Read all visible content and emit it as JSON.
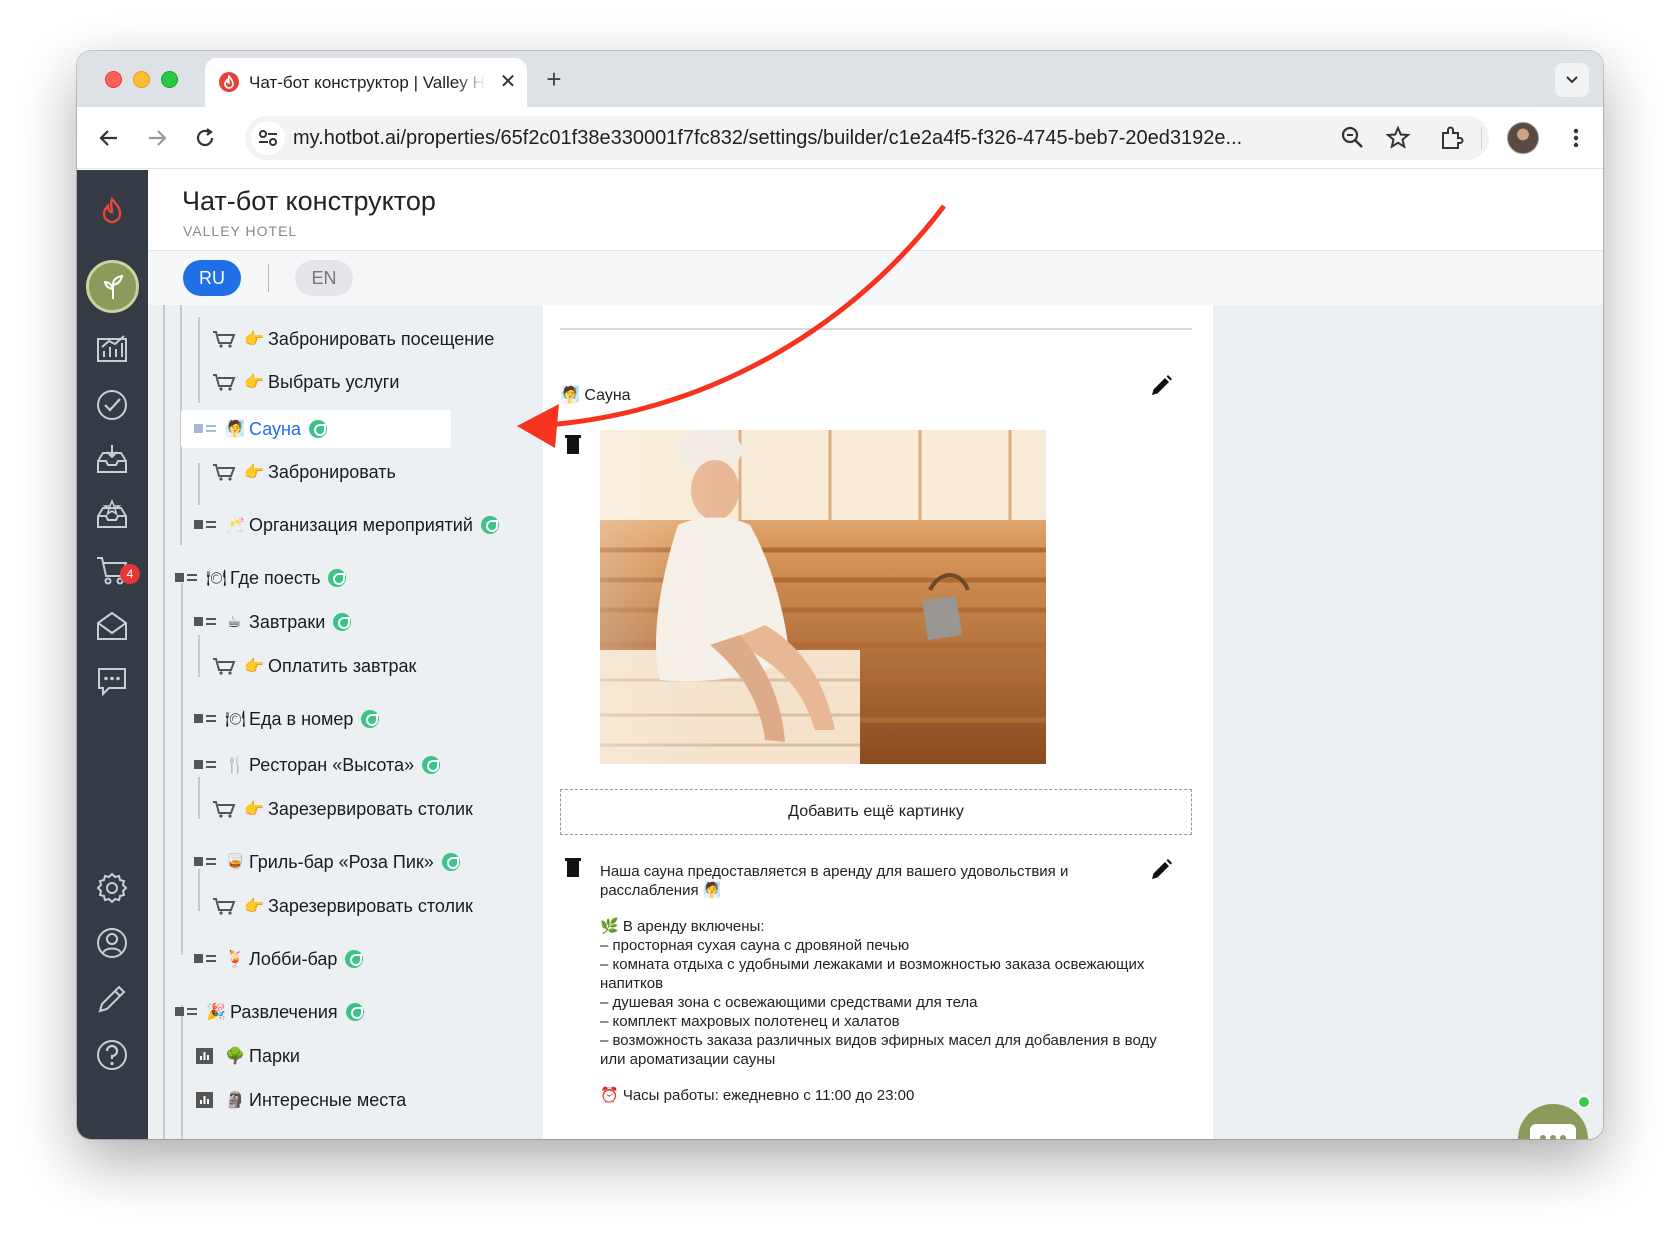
{
  "browser": {
    "tab_title": "Чат-бот конструктор | Valley Hotel",
    "url": "my.hotbot.ai/properties/65f2c01f38e330001f7fc832/settings/builder/c1e2a4f5-f326-4745-beb7-20ed3192e..."
  },
  "header": {
    "title": "Чат-бот конструктор",
    "subtitle": "VALLEY HOTEL"
  },
  "languages": [
    "RU",
    "EN"
  ],
  "rail": {
    "cart_badge": "4"
  },
  "tree": {
    "items": [
      {
        "label": "Забронировать посещение",
        "emoji": "👉"
      },
      {
        "label": "Выбрать услуги",
        "emoji": "👉"
      },
      {
        "label": "Сауна",
        "emoji": "🧖"
      },
      {
        "label": "Забронировать",
        "emoji": "👉"
      },
      {
        "label": "Организация мероприятий",
        "emoji": "🥂"
      },
      {
        "label": "Где поесть",
        "emoji": "🍽"
      },
      {
        "label": "Завтраки",
        "emoji": "☕"
      },
      {
        "label": "Оплатить завтрак",
        "emoji": "👉"
      },
      {
        "label": "Еда в номер",
        "emoji": "🍽"
      },
      {
        "label": "Ресторан «Высота»",
        "emoji": "🍴"
      },
      {
        "label": "Зарезервировать столик",
        "emoji": "👉"
      },
      {
        "label": "Гриль-бар «Роза Пик»",
        "emoji": "🥃"
      },
      {
        "label": "Зарезервировать столик",
        "emoji": "👉"
      },
      {
        "label": "Лобби-бар",
        "emoji": "🍹"
      },
      {
        "label": "Развлечения",
        "emoji": "🎉"
      },
      {
        "label": "Парки",
        "emoji": "🌳"
      },
      {
        "label": "Интересные места",
        "emoji": "🗿"
      }
    ]
  },
  "content": {
    "block_title": "Сауна",
    "block_emoji": "🧖",
    "add_image_label": "Добавить ещё картинку",
    "description": {
      "intro": "Наша сауна предоставляется в аренду для вашего удовольствия и расслабления 🧖",
      "included_heading": "🌿 В аренду включены:",
      "included_items": [
        "– просторная сухая сауна с дровяной печью",
        "– комната отдыха с удобными лежаками и возможностью заказа освежающих напитков",
        "– душевая зона с освежающими средствами для тела",
        "– комплект махровых полотенец и халатов",
        "– возможность заказа различных видов эфирных масел для добавления в воду или ароматизации сауны"
      ],
      "hours": "⏰ Часы работы: ежедневно с 11:00 до 23:00"
    }
  },
  "colors": {
    "accent": "#1f6fe5",
    "rail": "#343b44",
    "olive": "#8c9a5c",
    "annotation": "#f5331e",
    "leaf_badge": "#3cc38a"
  }
}
